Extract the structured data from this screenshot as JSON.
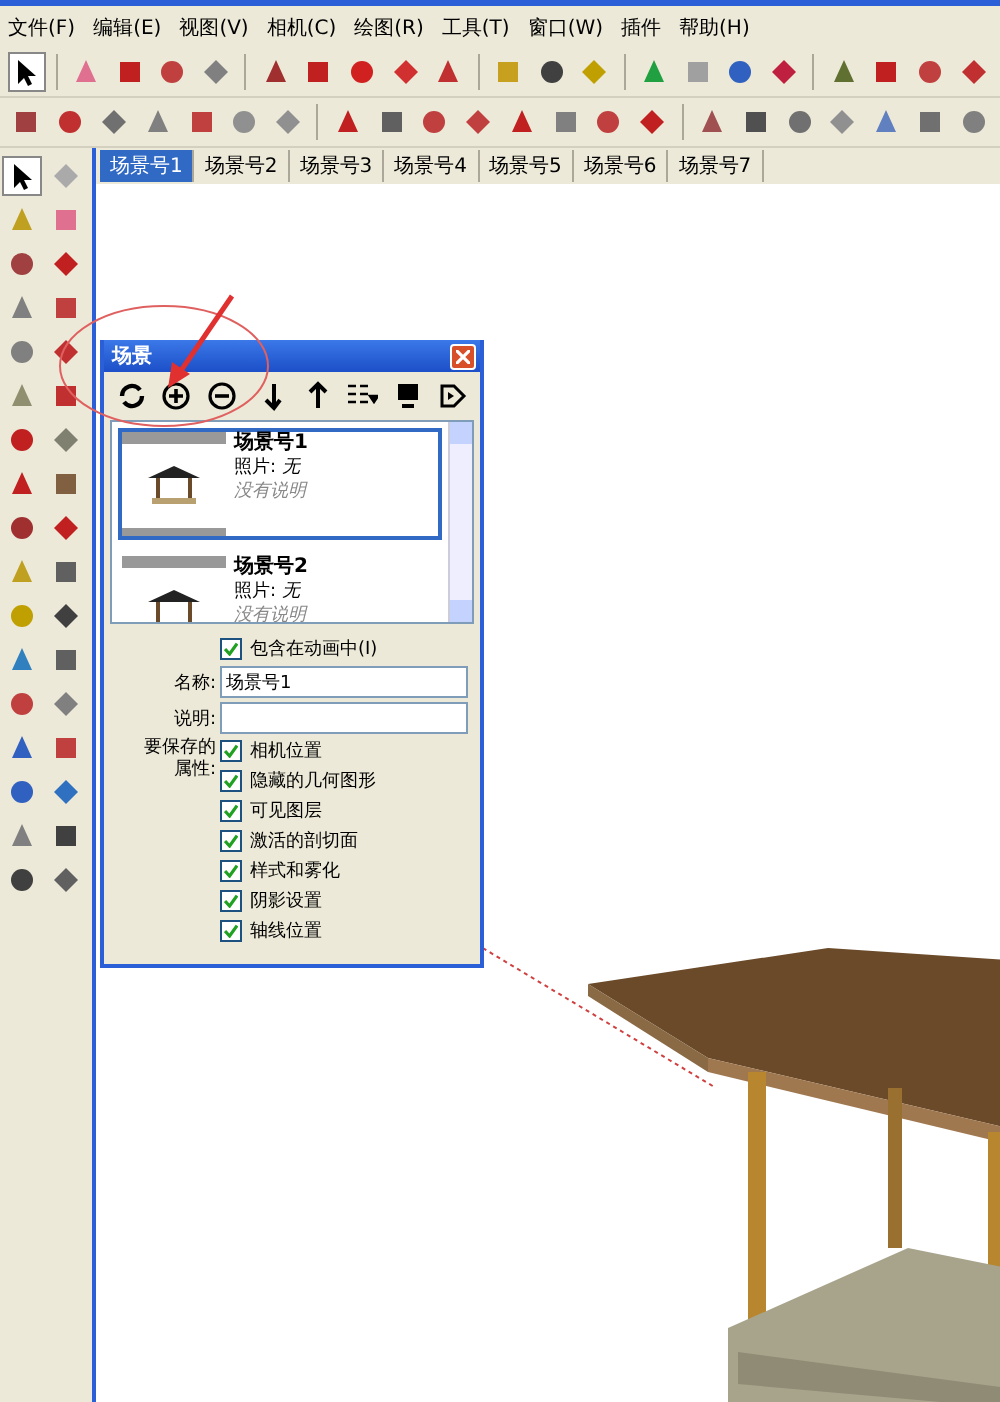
{
  "menu": [
    "文件(F)",
    "编辑(E)",
    "视图(V)",
    "相机(C)",
    "绘图(R)",
    "工具(T)",
    "窗口(W)",
    "插件",
    "帮助(H)"
  ],
  "scene_tabs": [
    {
      "label": "场景号1",
      "selected": true
    },
    {
      "label": "场景号2",
      "selected": false
    },
    {
      "label": "场景号3",
      "selected": false
    },
    {
      "label": "场景号4",
      "selected": false
    },
    {
      "label": "场景号5",
      "selected": false
    },
    {
      "label": "场景号6",
      "selected": false
    },
    {
      "label": "场景号7",
      "selected": false
    }
  ],
  "scenes_panel": {
    "title": "场景",
    "scenes": [
      {
        "name": "场景号1",
        "photo": "照片: *无*",
        "description": "没有说明",
        "selected": true
      },
      {
        "name": "场景号2",
        "photo": "照片: *无*",
        "description": "没有说明",
        "selected": false
      }
    ],
    "include_in_animation": {
      "label": "包含在动画中(I)",
      "checked": true
    },
    "name_label": "名称:",
    "name_value": "场景号1",
    "description_label": "说明:",
    "properties_label": "要保存的属性:",
    "properties": [
      {
        "label": "相机位置",
        "checked": true
      },
      {
        "label": "隐藏的几何图形",
        "checked": true
      },
      {
        "label": "可见图层",
        "checked": true
      },
      {
        "label": "激活的剖切面",
        "checked": true
      },
      {
        "label": "样式和雾化",
        "checked": true
      },
      {
        "label": "阴影设置",
        "checked": true
      },
      {
        "label": "轴线位置",
        "checked": true
      }
    ]
  }
}
